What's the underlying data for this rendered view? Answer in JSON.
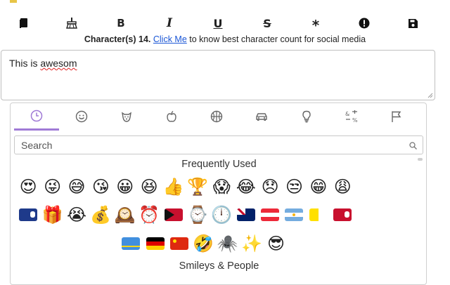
{
  "toolbar": {
    "bold_label": "B",
    "italic_label": "I",
    "underline_label": "U",
    "strike_label": "S",
    "asterisk_label": "*"
  },
  "count": {
    "prefix": "Character(s) 14.",
    "link": "Click Me",
    "suffix": "to know best character count for social media"
  },
  "editor": {
    "text_plain": "This is ",
    "text_misspelled": "awesom"
  },
  "emoji_panel": {
    "search_placeholder": "Search",
    "section_frequent": "Frequently Used",
    "section_smileys": "Smileys & People",
    "active_tab": "recent",
    "tabs": [
      "recent",
      "smileys",
      "animals",
      "food",
      "activities",
      "travel",
      "objects",
      "symbols",
      "flags"
    ],
    "row1": [
      "😍",
      "😜",
      "😅",
      "😘",
      "😀",
      "😆",
      "👍",
      "🏆",
      "😱",
      "😂",
      "😞",
      "😒",
      "😁",
      "😩"
    ],
    "row2": [
      "🇰🇾",
      "🎁",
      "😭",
      "💰",
      "🕰️",
      "⏰",
      "🇹🇱",
      "⌚",
      "🕛",
      "🇦🇺",
      "🇦🇹",
      "🇦🇷",
      "🇻🇦",
      "🇧🇲"
    ],
    "row3": [
      "🇦🇼",
      "🇩🇪",
      "🇨🇳",
      "🤣",
      "🕷️",
      "✨",
      "😎"
    ]
  },
  "colors": {
    "accent_tab": "#a07ad6",
    "link": "#1a56d6",
    "border": "#bfbfbf"
  }
}
